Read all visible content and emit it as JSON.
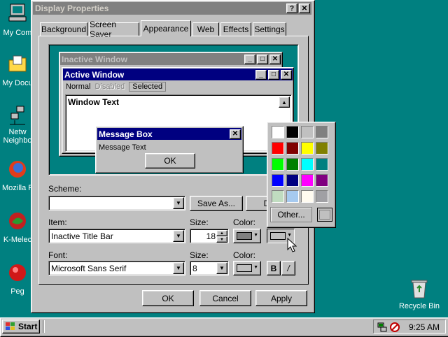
{
  "desktop": {
    "icons": [
      {
        "label": "My Com",
        "icon": "my-computer-icon"
      },
      {
        "label": "My Docu",
        "icon": "my-documents-icon"
      },
      {
        "label": "Netw",
        "label2": "Neighbo",
        "icon": "network-neighborhood-icon"
      },
      {
        "label": "Mozilla F",
        "icon": "mozilla-firefox-icon"
      },
      {
        "label": "K-Melec",
        "icon": "k-meleon-icon"
      },
      {
        "label": "Peg",
        "icon": "pegasus-icon"
      }
    ],
    "recycle_bin": {
      "label": "Recycle Bin",
      "icon": "recycle-bin-icon"
    }
  },
  "window": {
    "title": "Display Properties",
    "help_btn": "?",
    "close_btn": "✕",
    "tabs": [
      "Background",
      "Screen Saver",
      "Appearance",
      "Web",
      "Effects",
      "Settings"
    ],
    "active_tab": "Appearance",
    "preview": {
      "inactive_title": "Inactive Window",
      "active_title": "Active Window",
      "menu": [
        "Normal",
        "Disabled",
        "Selected"
      ],
      "window_text": "Window Text",
      "message_box_title": "Message Box",
      "message_text": "Message Text",
      "ok": "OK"
    },
    "scheme": {
      "label": "Scheme:",
      "value": "",
      "save_as": "Save As...",
      "delete": "D"
    },
    "item": {
      "label": "Item:",
      "value": "Inactive Title Bar",
      "size_label": "Size:",
      "size_value": "18",
      "color_label": "Color:",
      "color1": "#808080",
      "color2": "#c0c0c0"
    },
    "font": {
      "label": "Font:",
      "value": "Microsoft Sans Serif",
      "size_label": "Size:",
      "size_value": "8",
      "color_label": "Color:",
      "color": "#c0c0c0",
      "bold": "B",
      "italic": "/"
    },
    "buttons": {
      "ok": "OK",
      "cancel": "Cancel",
      "apply": "Apply"
    }
  },
  "palette": {
    "colors": [
      [
        "#ffffff",
        "#000000",
        "#c0c0c0",
        "#808080"
      ],
      [
        "#ff0000",
        "#800000",
        "#ffff00",
        "#808000"
      ],
      [
        "#00ff00",
        "#008000",
        "#00ffff",
        "#008080"
      ],
      [
        "#0000ff",
        "#000080",
        "#ff00ff",
        "#800080"
      ],
      [
        "#c0dcc0",
        "#a6caf0",
        "#fffbf0",
        "#a0a0a4"
      ]
    ],
    "other": "Other...",
    "selected": "#c0c0c0"
  },
  "taskbar": {
    "start": "Start",
    "clock": "9:25 AM"
  },
  "colors": {
    "desktop": "#008080",
    "active_title": "#000080",
    "inactive_title": "#808080",
    "face": "#c0c0c0"
  }
}
